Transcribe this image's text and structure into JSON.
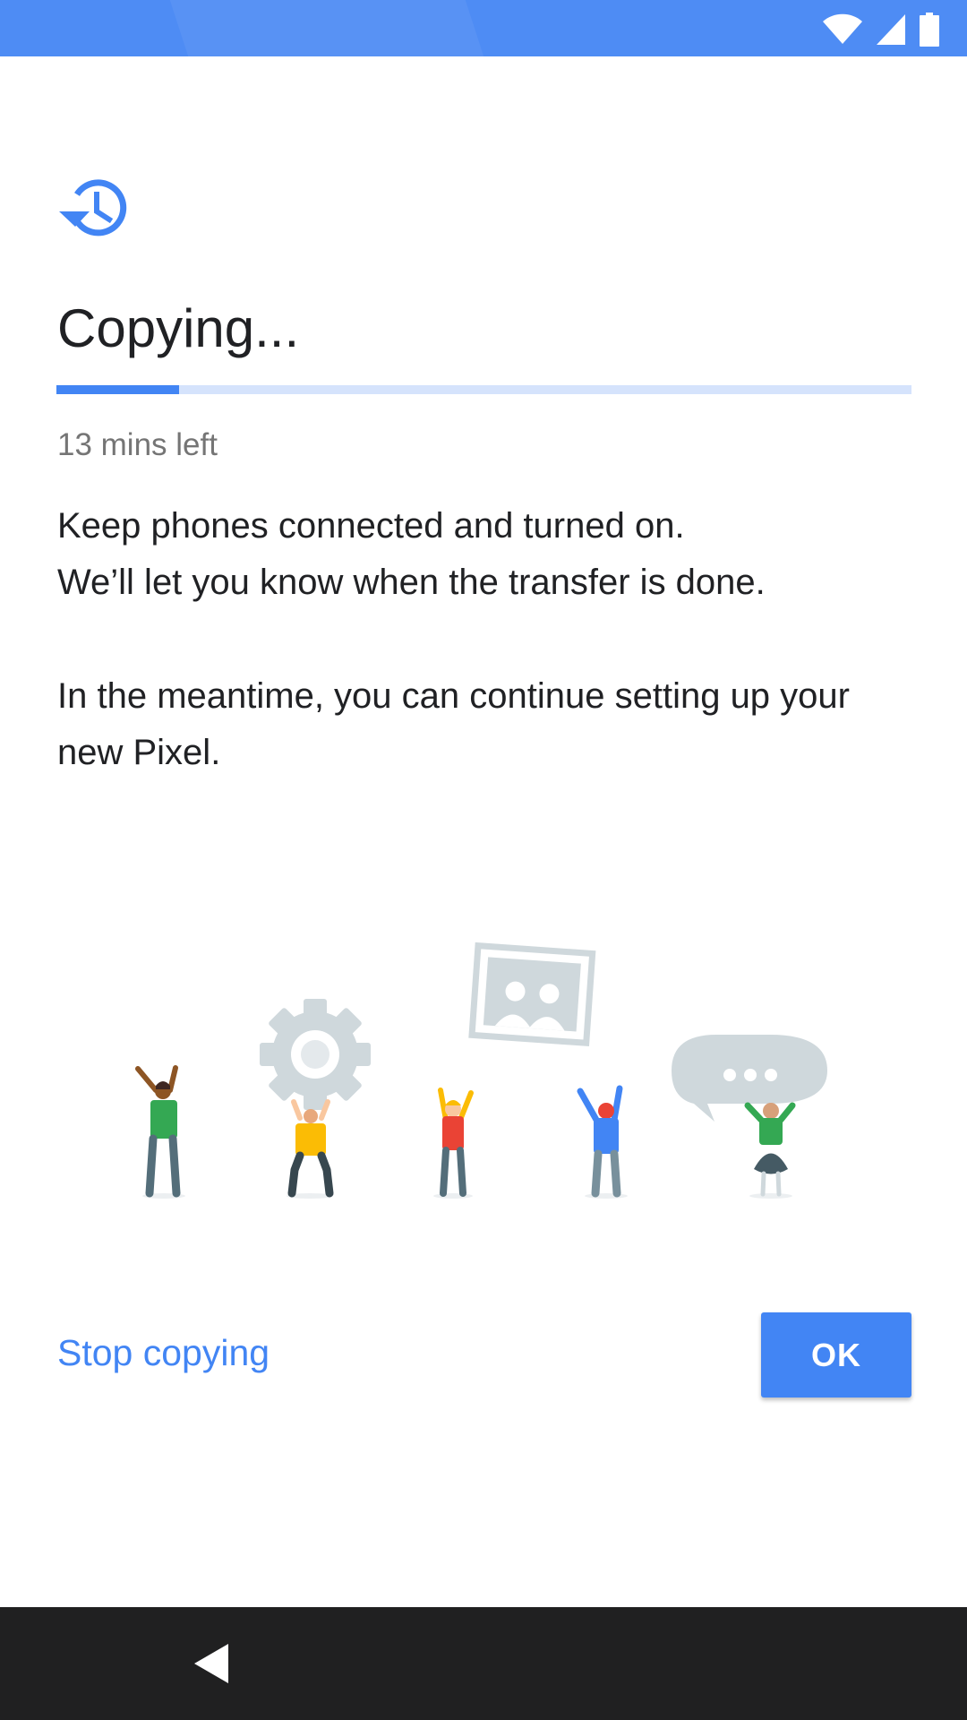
{
  "status_bar": {
    "background": "#4e8cf4",
    "icons": [
      "wifi-icon",
      "signal-icon",
      "battery-icon"
    ]
  },
  "header": {
    "icon": "restore-history-icon",
    "title": "Copying..."
  },
  "progress": {
    "fraction": 0.143,
    "fill_color": "#4285f4",
    "track_color": "#d5e3fc",
    "time_left": "13 mins left"
  },
  "body": {
    "line1": "Keep phones connected and turned on.",
    "line2": "We’ll let you know when the transfer is done.",
    "line3": "In the meantime, you can continue setting up your new Pixel."
  },
  "illustration": {
    "items": [
      "person-green-icon",
      "gear-icon",
      "person-yellow-icon",
      "photo-icon",
      "person-red-icon",
      "person-blue-icon",
      "chat-bubble-icon",
      "person-green-skirt-icon"
    ]
  },
  "actions": {
    "stop_label": "Stop copying",
    "ok_label": "OK",
    "accent": "#4285f4"
  },
  "nav_bar": {
    "back_icon": "back-icon"
  }
}
